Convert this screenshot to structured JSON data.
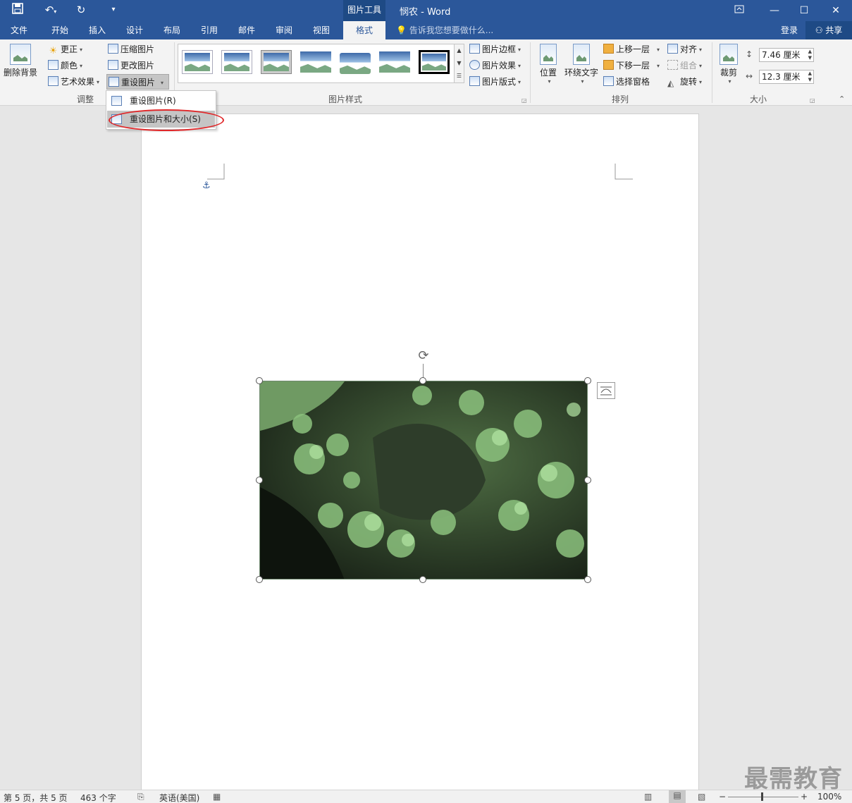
{
  "window": {
    "title": "悯农 - Word",
    "context_tab_group": "图片工具",
    "quick_access": {
      "save": "save-icon",
      "undo": "undo-icon",
      "redo": "redo-icon",
      "customize": "customize-qat-icon"
    },
    "controls": {
      "ribbon_display": "ribbon-display-icon",
      "minimize": "—",
      "maximize": "☐",
      "close": "✕"
    }
  },
  "tabs": [
    {
      "label": "文件"
    },
    {
      "label": "开始"
    },
    {
      "label": "插入"
    },
    {
      "label": "设计"
    },
    {
      "label": "布局"
    },
    {
      "label": "引用"
    },
    {
      "label": "邮件"
    },
    {
      "label": "审阅"
    },
    {
      "label": "视图"
    },
    {
      "label": "格式",
      "active": true
    }
  ],
  "tell_me": "告诉我您想要做什么...",
  "account": {
    "login": "登录",
    "share": "共享"
  },
  "ribbon": {
    "adjust": {
      "remove_bg": "删除背景",
      "corrections": "更正",
      "color": "颜色",
      "artistic": "艺术效果",
      "compress": "压缩图片",
      "change": "更改图片",
      "reset": "重设图片",
      "label": "调整"
    },
    "styles": {
      "border": "图片边框",
      "effects": "图片效果",
      "layout": "图片版式",
      "label": "图片样式"
    },
    "arrange": {
      "position": "位置",
      "wrap": "环绕文字",
      "forward": "上移一层",
      "backward": "下移一层",
      "selection_pane": "选择窗格",
      "align": "对齐",
      "group": "组合",
      "rotate": "旋转",
      "label": "排列"
    },
    "size": {
      "crop": "裁剪",
      "height": "7.46 厘米",
      "width": "12.3 厘米",
      "label": "大小"
    }
  },
  "reset_menu": {
    "item1": "重设图片(R)",
    "item2": "重设图片和大小(S)"
  },
  "status": {
    "page": "第 5 页，共 5 页",
    "words": "463 个字",
    "language": "英语(美国)",
    "zoom": "100%",
    "zoom_minus": "−",
    "zoom_plus": "+"
  },
  "watermark": "最需教育",
  "colors": {
    "accent": "#2b579a",
    "highlight_oval": "#e0282a"
  }
}
